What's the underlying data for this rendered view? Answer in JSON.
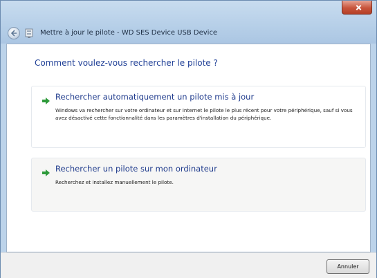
{
  "window": {
    "title": "Mettre à jour le pilote - WD SES Device USB Device"
  },
  "content": {
    "heading": "Comment voulez-vous rechercher le pilote ?",
    "options": [
      {
        "title": "Rechercher automatiquement un pilote mis à jour",
        "description": "Windows va rechercher sur votre ordinateur et sur Internet le pilote le plus récent pour votre périphérique, sauf si vous avez désactivé cette fonctionnalité dans les paramètres d'installation du périphérique."
      },
      {
        "title": "Rechercher un pilote sur mon ordinateur",
        "description": "Recherchez et installez manuellement le pilote."
      }
    ]
  },
  "footer": {
    "cancel_label": "Annuler"
  },
  "colors": {
    "accent_green": "#2e9a3a",
    "link_blue": "#1e3a8c"
  },
  "icons": {
    "back": "back-arrow-icon",
    "wizard": "hardware-wizard-icon",
    "option_arrow": "green-arrow-icon",
    "close": "close-icon"
  }
}
